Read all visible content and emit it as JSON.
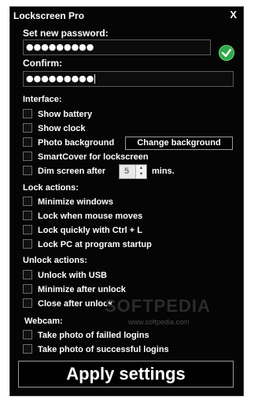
{
  "window": {
    "title": "Lockscreen Pro",
    "close_label": "X"
  },
  "password": {
    "label": "Set new password:",
    "value": "●●●●●●●●●",
    "confirm_label": "Confirm:",
    "confirm_value": "●●●●●●●●●"
  },
  "interface": {
    "heading": "Interface:",
    "show_battery": "Show battery",
    "show_clock": "Show clock",
    "photo_background": "Photo background",
    "change_background": "Change background",
    "smartcover": "SmartCover for lockscreen",
    "dim_screen": "Dim screen after",
    "dim_value": "5",
    "dim_unit": "mins."
  },
  "lock_actions": {
    "heading": "Lock actions:",
    "minimize_windows": "Minimize windows",
    "mouse_moves": "Lock when mouse moves",
    "ctrl_l": "Lock quickly with Ctrl + L",
    "startup": "Lock PC at program startup"
  },
  "unlock_actions": {
    "heading": "Unlock actions:",
    "usb": "Unlock with USB",
    "minimize_after": "Minimize after unlock",
    "close_after": "Close after unlock"
  },
  "webcam": {
    "heading": "Webcam:",
    "failed": "Take photo of failled logins",
    "successful": "Take photo of successful logins"
  },
  "watermark": {
    "text": "SOFTPEDIA",
    "sub": "www.softpedia.com"
  },
  "apply_label": "Apply settings"
}
